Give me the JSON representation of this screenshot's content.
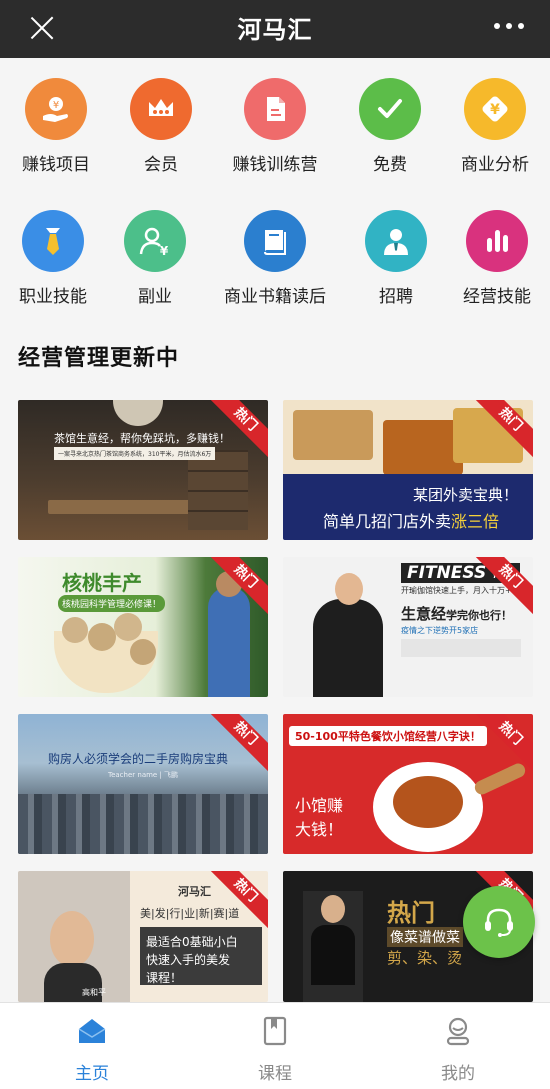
{
  "header": {
    "title": "河马汇"
  },
  "categories_row1": [
    {
      "label": "赚钱项目",
      "icon": "money-hand-icon",
      "color": "#f08a3c"
    },
    {
      "label": "会员",
      "icon": "crown-icon",
      "color": "#ef6a2f"
    },
    {
      "label": "赚钱训练营",
      "icon": "document-icon",
      "color": "#ef6b6b"
    },
    {
      "label": "免费",
      "icon": "checkmark-icon",
      "color": "#5cbd49"
    },
    {
      "label": "商业分析",
      "icon": "yen-diamond-icon",
      "color": "#f6b92b"
    }
  ],
  "categories_row2": [
    {
      "label": "职业技能",
      "icon": "necktie-icon",
      "color": "#3a8ee6"
    },
    {
      "label": "副业",
      "icon": "person-yen-icon",
      "color": "#4cbf8a"
    },
    {
      "label": "商业书籍读后",
      "icon": "book-icon",
      "color": "#2b7fcf"
    },
    {
      "label": "招聘",
      "icon": "recruiter-icon",
      "color": "#31b3c4"
    },
    {
      "label": "经营技能",
      "icon": "bar-chart-icon",
      "color": "#d9327e"
    }
  ],
  "section": {
    "title": "经营管理更新中"
  },
  "hot_badge": "热门",
  "cards": [
    {
      "line1": "茶馆生意经，帮你免踩坑，多赚钱！",
      "line2": "一案寻来北京热门茶馆商务系统，310平米，月估流水6万"
    },
    {
      "line1": "某团外卖宝典！",
      "line2a": "简单几招门店外卖",
      "line2b": "涨三倍"
    },
    {
      "line1": "核桃丰产",
      "line2": "核桃园科学管理必修课！"
    },
    {
      "brand": "FITNESS",
      "brand_sub": "YUJIA",
      "line1": "开瑜伽馆快速上手，月入十万+",
      "line2a": "生意经",
      "line2b": "学完你也行！",
      "line3": "疫情之下逆势开5家店"
    },
    {
      "line1": "购房人必须学会的二手房购房宝典",
      "line2": "Teacher name | 飞鹏"
    },
    {
      "line1": "50-100平特色餐饮小馆经营八字诀！",
      "line2": "小馆赚",
      "line3": "大钱！"
    },
    {
      "brand": "河马汇",
      "line1": "美|发|行|业|新|赛|道",
      "line2": "最适合0基础小白",
      "line3": "快速入手的美发",
      "line4": "课程！",
      "teacher": "高和平"
    },
    {
      "line1": "热门",
      "line2": "像菜谱做菜",
      "line3": "剪、染、烫"
    }
  ],
  "bottom_nav": [
    {
      "label": "主页",
      "icon": "home-icon",
      "active": true
    },
    {
      "label": "课程",
      "icon": "bookmark-icon",
      "active": false
    },
    {
      "label": "我的",
      "icon": "profile-icon",
      "active": false
    }
  ],
  "colors": {
    "accent": "#2b82d9",
    "hot": "#d8262b",
    "support": "#6cc24a"
  }
}
